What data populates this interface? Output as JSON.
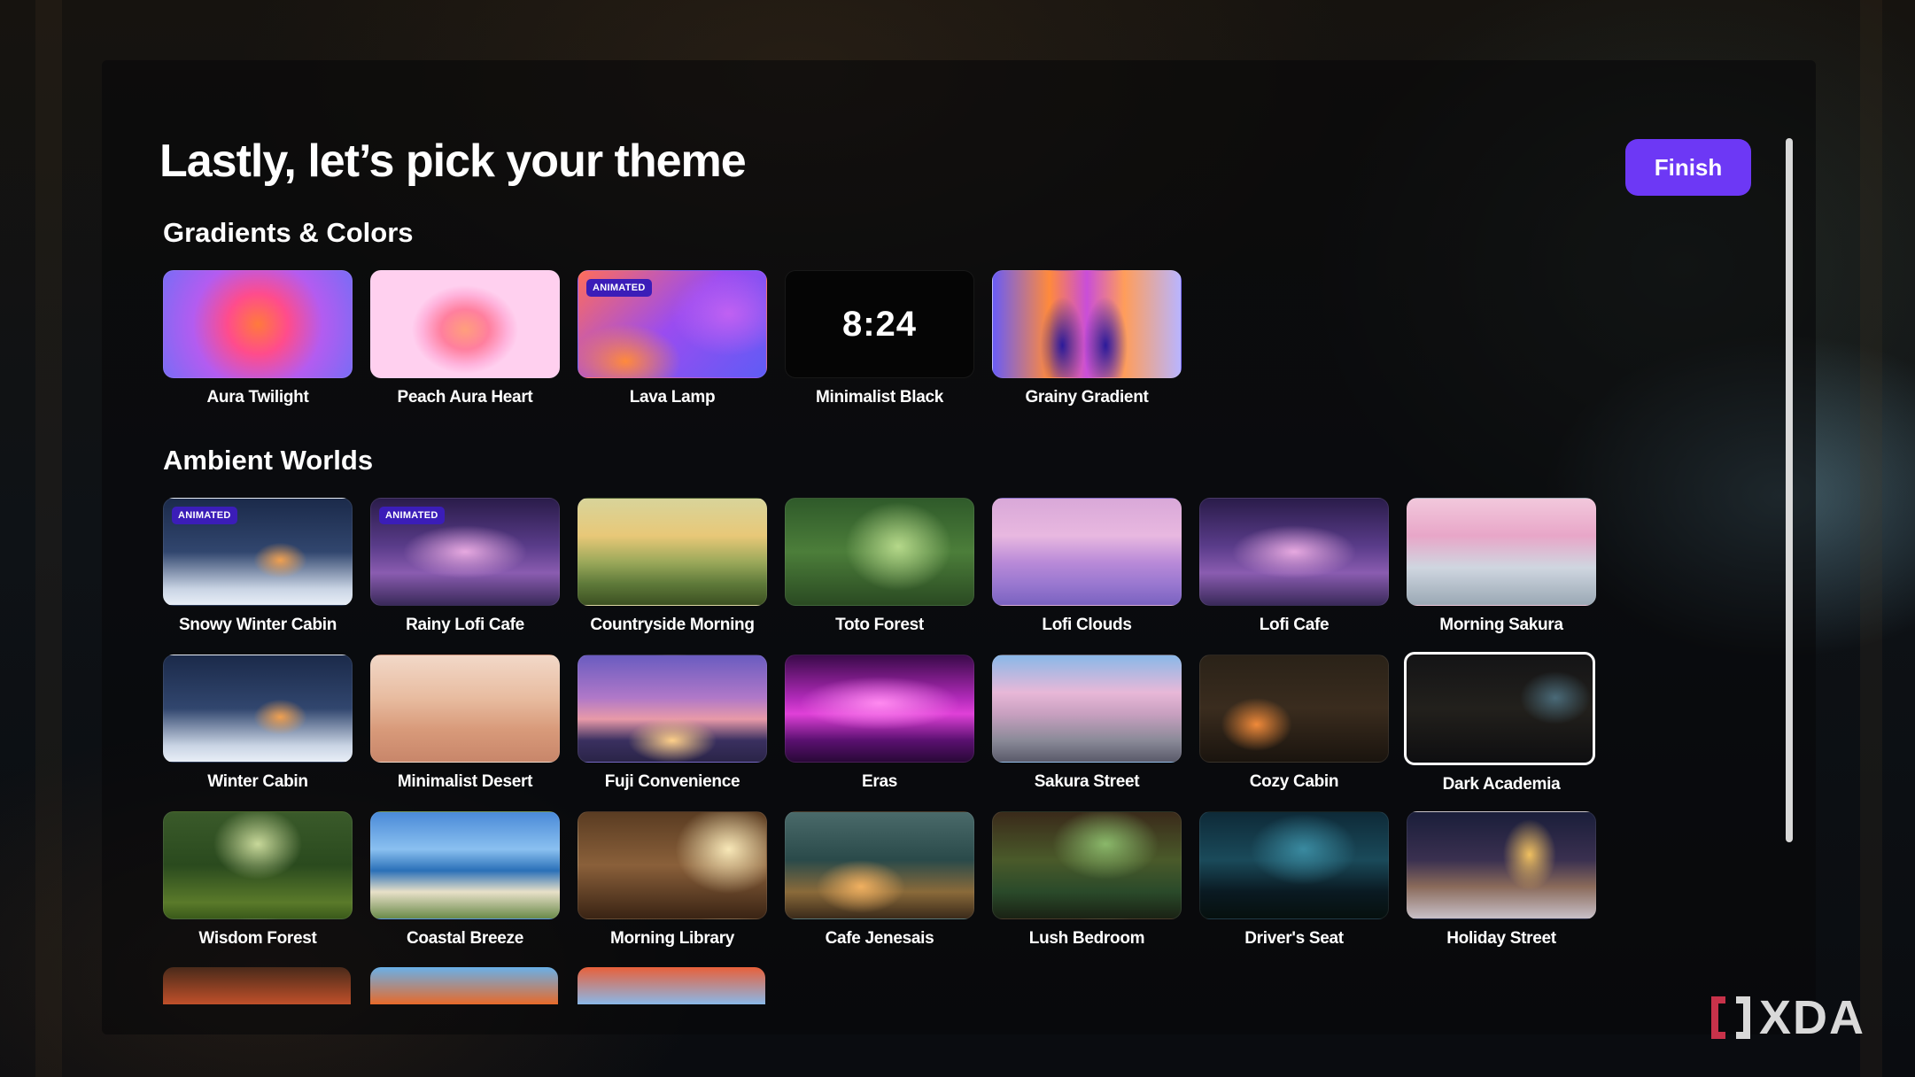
{
  "page": {
    "title": "Lastly, let’s pick your theme",
    "finish_label": "Finish"
  },
  "sections": {
    "gradients": {
      "title": "Gradients & Colors",
      "items": [
        {
          "label": "Aura Twilight"
        },
        {
          "label": "Peach Aura Heart"
        },
        {
          "label": "Lava Lamp",
          "badge": "ANIMATED"
        },
        {
          "label": "Minimalist Black",
          "clock": "8:24"
        },
        {
          "label": "Grainy Gradient"
        }
      ]
    },
    "ambient": {
      "title": "Ambient Worlds",
      "items": [
        {
          "label": "Snowy Winter Cabin",
          "badge": "ANIMATED"
        },
        {
          "label": "Rainy Lofi Cafe",
          "badge": "ANIMATED"
        },
        {
          "label": "Countryside Morning"
        },
        {
          "label": "Toto Forest"
        },
        {
          "label": "Lofi Clouds"
        },
        {
          "label": "Lofi Cafe"
        },
        {
          "label": "Morning Sakura"
        },
        {
          "label": "Winter Cabin"
        },
        {
          "label": "Minimalist Desert"
        },
        {
          "label": "Fuji Convenience"
        },
        {
          "label": "Eras"
        },
        {
          "label": "Sakura Street"
        },
        {
          "label": "Cozy Cabin"
        },
        {
          "label": "Dark Academia",
          "selected": true
        },
        {
          "label": "Wisdom Forest"
        },
        {
          "label": "Coastal Breeze"
        },
        {
          "label": "Morning Library"
        },
        {
          "label": "Cafe Jenesais"
        },
        {
          "label": "Lush Bedroom"
        },
        {
          "label": "Driver's Seat"
        },
        {
          "label": "Holiday Street"
        }
      ]
    }
  },
  "watermark": {
    "text": "XDA"
  },
  "colors": {
    "accent": "#6d38f5",
    "badge": "#3b1db8"
  }
}
